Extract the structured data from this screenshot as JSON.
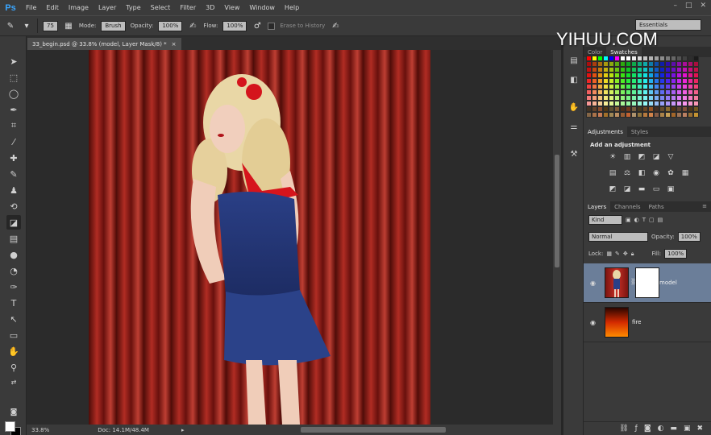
{
  "app": {
    "logo": "Ps",
    "accent": "#3aa6ff"
  },
  "menu": [
    "File",
    "Edit",
    "Image",
    "Layer",
    "Type",
    "Select",
    "Filter",
    "3D",
    "View",
    "Window",
    "Help"
  ],
  "window_controls": {
    "minimize": "–",
    "restore": "□",
    "close": "✕"
  },
  "options": {
    "brush_size": "75",
    "mode_label": "Mode:",
    "mode_value": "Brush",
    "opacity_label": "Opacity:",
    "opacity_value": "100%",
    "flow_label": "Flow:",
    "flow_value": "100%",
    "erase_history": "Erase to History",
    "workspace": "Essentials"
  },
  "document": {
    "tab_title": "33_begin.psd @ 33.8% (model, Layer Mask/8) *",
    "close": "×",
    "zoom": "33.8%",
    "doc_info": "Doc: 14.1M/48.4M"
  },
  "watermark": {
    "text": "YIHUU.COM"
  },
  "panels": {
    "color_tabs": [
      "Color",
      "Swatches"
    ],
    "adjust_tabs": [
      "Adjustments",
      "Styles"
    ],
    "adjust_title": "Add an adjustment",
    "layer_tabs": [
      "Layers",
      "Channels",
      "Paths"
    ],
    "kind_value": "Kind",
    "blend_value": "Normal",
    "opacity_label": "Opacity:",
    "opacity_value": "100%",
    "lock_label": "Lock:",
    "fill_label": "Fill:",
    "fill_value": "100%",
    "layers": [
      {
        "name": "model",
        "selected": true
      },
      {
        "name": "fire",
        "selected": false
      }
    ]
  }
}
